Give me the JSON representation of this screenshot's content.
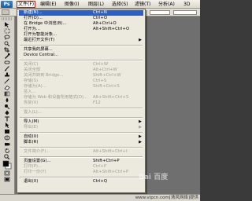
{
  "menubar": {
    "logo": "Ps",
    "items": [
      {
        "label": "文件(F)",
        "active": true
      },
      {
        "label": "编辑(E)"
      },
      {
        "label": "图像(I)"
      },
      {
        "label": "图层(L)"
      },
      {
        "label": "选择(S)"
      },
      {
        "label": "滤镜(T)"
      },
      {
        "label": "分析(A)"
      },
      {
        "label": "3D"
      }
    ]
  },
  "file_menu": {
    "items": [
      {
        "label": "新建(N)...",
        "shortcut": "Ctrl+N",
        "highlighted": true
      },
      {
        "label": "打开(O)...",
        "shortcut": "Ctrl+O"
      },
      {
        "label": "在 Bridge 中浏览(B)...",
        "shortcut": "Alt+Ctrl+O"
      },
      {
        "label": "打开为...",
        "shortcut": "Alt+Shift+Ctrl+O"
      },
      {
        "label": "打开为智能对象..."
      },
      {
        "label": "最近打开文件(T)",
        "submenu": true
      },
      {
        "label": "共享我的屏幕..."
      },
      {
        "label": "Device Central..."
      },
      {
        "label": "关闭(C)",
        "shortcut": "Ctrl+W",
        "disabled": true
      },
      {
        "label": "关闭全部",
        "shortcut": "Alt+Ctrl+W",
        "disabled": true
      },
      {
        "label": "关闭并转到 Bridge...",
        "shortcut": "Shift+Ctrl+W",
        "disabled": true
      },
      {
        "label": "存储(S)",
        "shortcut": "Ctrl+S",
        "disabled": true
      },
      {
        "label": "存储为(A)...",
        "shortcut": "Shift+Ctrl+S",
        "disabled": true
      },
      {
        "label": "签入...",
        "disabled": true
      },
      {
        "label": "存储为 Web 和设备所用格式(D)...",
        "shortcut": "Alt+Shift+Ctrl+S",
        "disabled": true
      },
      {
        "label": "恢复(V)",
        "shortcut": "F12",
        "disabled": true
      },
      {
        "label": "置入(L)...",
        "disabled": true
      },
      {
        "label": "导入(M)",
        "submenu": true
      },
      {
        "label": "导出(E)",
        "submenu": true,
        "disabled": true
      },
      {
        "label": "自动(U)",
        "submenu": true
      },
      {
        "label": "脚本(R)",
        "submenu": true
      },
      {
        "label": "文件简介(F)...",
        "shortcut": "Alt+Shift+Ctrl+I",
        "disabled": true
      },
      {
        "label": "页面设置(G)...",
        "shortcut": "Shift+Ctrl+P"
      },
      {
        "label": "打印(P)...",
        "shortcut": "Ctrl+P",
        "disabled": true
      },
      {
        "label": "打印一份(Y)",
        "shortcut": "Alt+Shift+Ctrl+P",
        "disabled": true
      },
      {
        "label": "退出(X)",
        "shortcut": "Ctrl+Q"
      }
    ]
  },
  "statusbar": {
    "text": "www.vipcn.com[清风网络]提供"
  },
  "watermark": {
    "text": "Bai 百度"
  }
}
